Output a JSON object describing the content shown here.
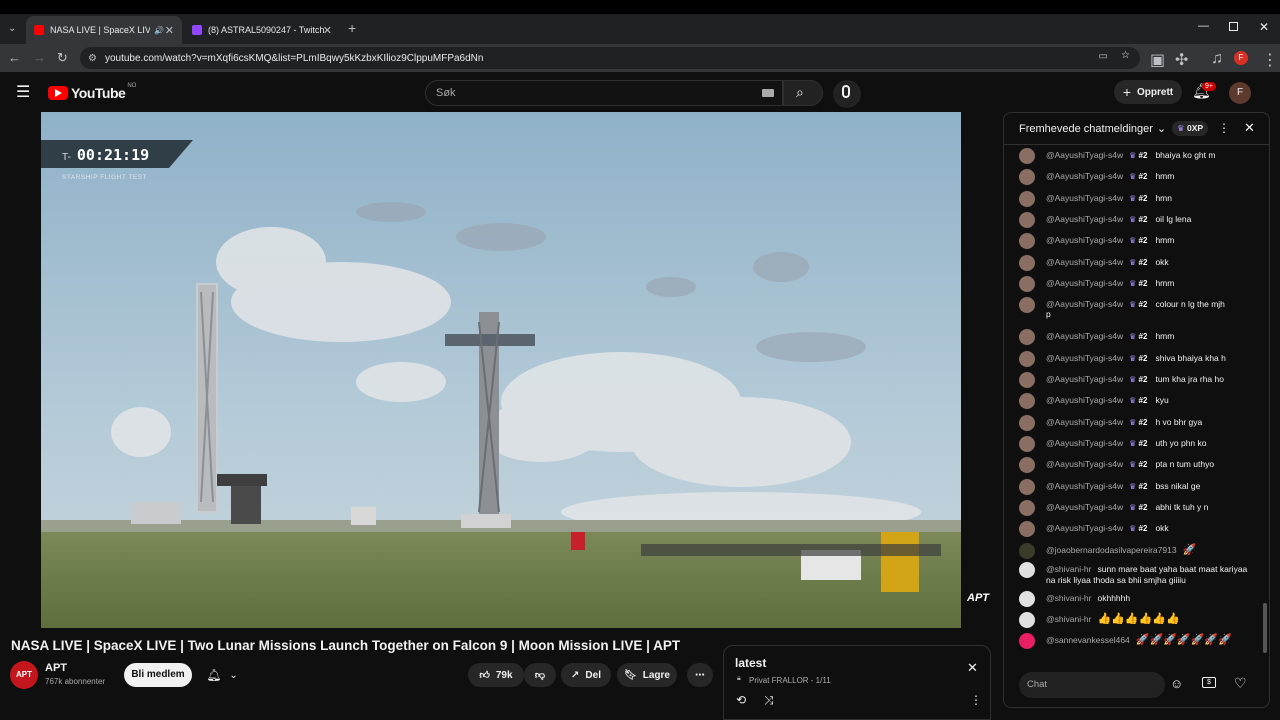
{
  "browser": {
    "tabs": [
      {
        "title": "NASA LIVE | SpaceX LIVE | T",
        "active": true
      },
      {
        "title": "(8) ASTRAL5090247 - Twitch",
        "active": false
      }
    ],
    "url": "youtube.com/watch?v=mXqfi6csKMQ&list=PLmIBqwy5kKzbxKIlioz9ClppuMFPa6dNn",
    "profile_initial": "F"
  },
  "youtube": {
    "logo_text": "YouTube",
    "country": "NO",
    "search_placeholder": "Søk",
    "create_label": "Opprett",
    "notif_count": "9+",
    "avatar_initial": "F"
  },
  "video": {
    "timer": "T-  00:21:19",
    "timer_prefix": "T-",
    "timer_value": "00:21:19",
    "timer_caption": "STARSHIP FLIGHT TEST",
    "watermark": "APT",
    "title": "NASA LIVE | SpaceX LIVE | Two Lunar Missions Launch Together on Falcon 9 | Moon Mission LIVE | APT"
  },
  "channel": {
    "name": "APT",
    "subscribers": "767k abonnenter",
    "join_label": "Bli medlem",
    "likes": "79k",
    "share_label": "Del",
    "save_label": "Lagre"
  },
  "playlist": {
    "title": "latest",
    "meta": "Privat FRALLOR - 1/11"
  },
  "chat": {
    "header": "Fremhevede chatmeldinger",
    "xp_badge": "0XP",
    "input_placeholder": "Chat",
    "messages": [
      {
        "author": "@AayushiTyagi-s4w",
        "badge": "#2",
        "text": "bhaiya ko ght m"
      },
      {
        "author": "@AayushiTyagi-s4w",
        "badge": "#2",
        "text": "hmm"
      },
      {
        "author": "@AayushiTyagi-s4w",
        "badge": "#2",
        "text": "hmn"
      },
      {
        "author": "@AayushiTyagi-s4w",
        "badge": "#2",
        "text": "oil lg lena"
      },
      {
        "author": "@AayushiTyagi-s4w",
        "badge": "#2",
        "text": "hmm"
      },
      {
        "author": "@AayushiTyagi-s4w",
        "badge": "#2",
        "text": "okk"
      },
      {
        "author": "@AayushiTyagi-s4w",
        "badge": "#2",
        "text": "hmm"
      },
      {
        "author": "@AayushiTyagi-s4w",
        "badge": "#2",
        "text": "colour n lg the mjh"
      },
      {
        "author": "@AayushiTyagi-s4w",
        "badge": "#2",
        "text": "hmm"
      },
      {
        "author": "@AayushiTyagi-s4w",
        "badge": "#2",
        "text": "shiva bhaiya kha h"
      },
      {
        "author": "@AayushiTyagi-s4w",
        "badge": "#2",
        "text": "tum kha jra rha ho"
      },
      {
        "author": "@AayushiTyagi-s4w",
        "badge": "#2",
        "text": "kyu"
      },
      {
        "author": "@AayushiTyagi-s4w",
        "badge": "#2",
        "text": "h vo bhr gya"
      },
      {
        "author": "@AayushiTyagi-s4w",
        "badge": "#2",
        "text": "uth yo phn ko"
      },
      {
        "author": "@AayushiTyagi-s4w",
        "badge": "#2",
        "text": "pta n tum uthyo"
      },
      {
        "author": "@AayushiTyagi-s4w",
        "badge": "#2",
        "text": "bss nikal ge"
      },
      {
        "author": "@AayushiTyagi-s4w",
        "badge": "#2",
        "text": "abhi tk tuh y n"
      },
      {
        "author": "@AayushiTyagi-s4w",
        "badge": "#2",
        "text": "okk"
      },
      {
        "author": "@joaobernardodasilvapereira7913",
        "badge": "",
        "text": "🚀"
      },
      {
        "author": "@shivani-hr",
        "badge": "",
        "text": "sunn mare baat yaha baat maat kariyaa na risk liyaa thoda sa bhii smjha giiiiu"
      },
      {
        "author": "@shivani-hr",
        "badge": "",
        "text": "okhhhhh"
      },
      {
        "author": "@shivani-hr",
        "badge": "",
        "text": "👍👍👍👍👍👍"
      },
      {
        "author": "@sannevankessel464",
        "badge": "",
        "text": "🚀🚀🚀🚀🚀🚀🚀"
      }
    ],
    "wrap_tail": "p"
  }
}
